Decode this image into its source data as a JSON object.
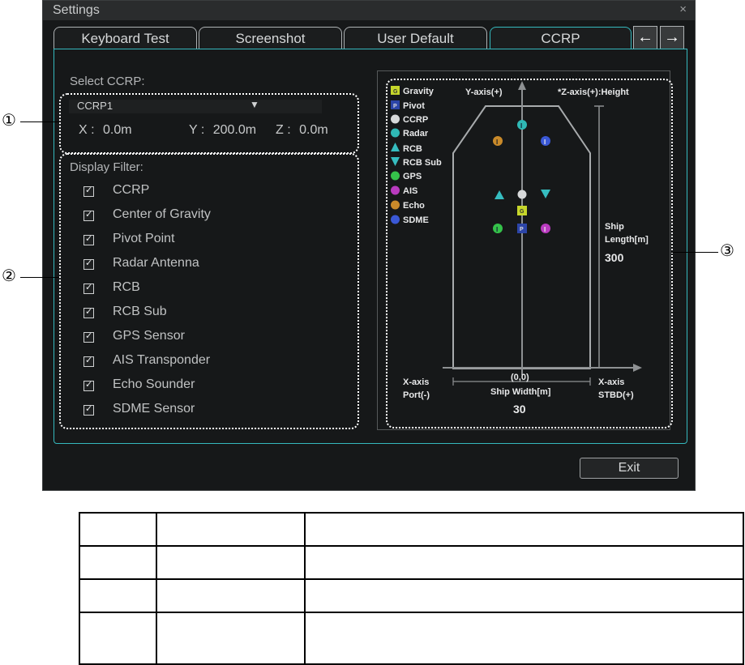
{
  "window": {
    "title": "Settings",
    "close_glyph": "×"
  },
  "tabs": [
    {
      "label": "Keyboard Test",
      "active": false
    },
    {
      "label": "Screenshot",
      "active": false
    },
    {
      "label": "User Default",
      "active": false
    },
    {
      "label": "CCRP",
      "active": true
    }
  ],
  "tab_nav": {
    "prev_glyph": "←",
    "next_glyph": "→",
    "prev_icon": "arrow-left-icon",
    "next_icon": "arrow-right-icon"
  },
  "select_ccrp": {
    "label": "Select CCRP:",
    "selected": "CCRP1",
    "caret": "▼",
    "x_label": "X :",
    "x_value": "0.0m",
    "y_label": "Y :",
    "y_value": "200.0m",
    "z_label": "Z :",
    "z_value": "0.0m"
  },
  "display_filter": {
    "label": "Display Filter:",
    "items": [
      {
        "label": "CCRP",
        "checked": true
      },
      {
        "label": "Center of Gravity",
        "checked": true
      },
      {
        "label": "Pivot Point",
        "checked": true
      },
      {
        "label": "Radar Antenna",
        "checked": true
      },
      {
        "label": "RCB",
        "checked": true
      },
      {
        "label": "RCB Sub",
        "checked": true
      },
      {
        "label": "GPS Sensor",
        "checked": true
      },
      {
        "label": "AIS Transponder",
        "checked": true
      },
      {
        "label": "Echo Sounder",
        "checked": true
      },
      {
        "label": "SDME Sensor",
        "checked": true
      }
    ]
  },
  "diagram": {
    "legend": [
      {
        "label": "Gravity",
        "color": "#c6d62b",
        "letter": "G"
      },
      {
        "label": "Pivot",
        "color": "#2c45a8",
        "letter": "P"
      },
      {
        "label": "CCRP",
        "color": "#d7d9da"
      },
      {
        "label": "Radar",
        "color": "#2fb8b5"
      },
      {
        "label": "RCB",
        "color": "#36bdc0"
      },
      {
        "label": "RCB Sub",
        "color": "#36bdc0"
      },
      {
        "label": "GPS",
        "color": "#35c24a"
      },
      {
        "label": "AIS",
        "color": "#b93bbf"
      },
      {
        "label": "Echo",
        "color": "#c98a2a"
      },
      {
        "label": "SDME",
        "color": "#3a58d6"
      }
    ],
    "y_axis_label": "Y-axis(+)",
    "z_axis_label": "*Z-axis(+):Height",
    "ship_length_label_1": "Ship",
    "ship_length_label_2": "Length[m]",
    "ship_length_value": "300",
    "origin_label": "(0,0)",
    "ship_width_label": "Ship Width[m]",
    "ship_width_value": "30",
    "x_port_label_1": "X-axis",
    "x_port_label_2": "Port(-)",
    "x_stbd_label_1": "X-axis",
    "x_stbd_label_2": "STBD(+)",
    "marker_glyph": "I",
    "gravity_letter": "G",
    "pivot_letter": "P"
  },
  "callouts": {
    "c1": "①",
    "c2": "②",
    "c3": "③"
  },
  "exit_button": "Exit",
  "colors": {
    "accent": "#35b9be",
    "background": "#161819"
  }
}
